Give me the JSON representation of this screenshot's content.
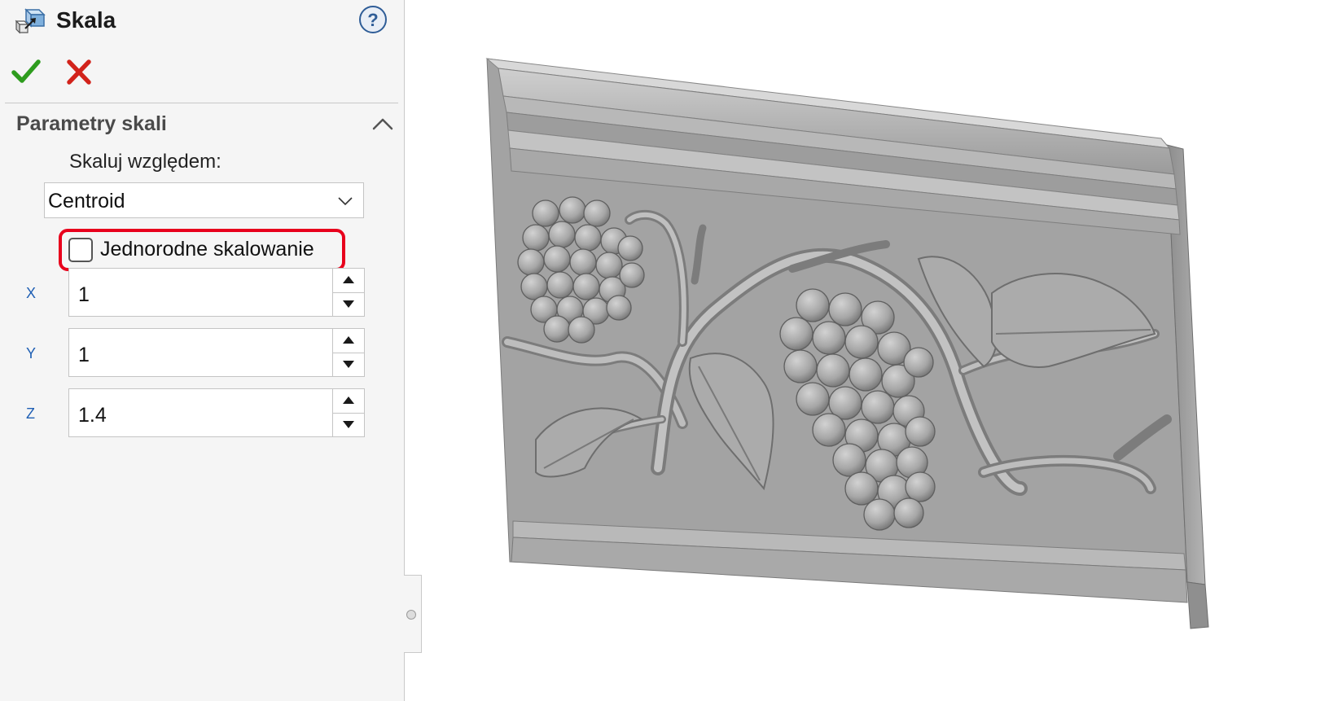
{
  "header": {
    "title": "Skala",
    "feature_icon": "scale-feature-icon",
    "help_icon": "help-icon"
  },
  "actions": {
    "ok_icon": "checkmark-icon",
    "cancel_icon": "close-icon"
  },
  "group": {
    "title": "Parametry skali",
    "collapse_icon": "chevron-up-icon",
    "scale_about_label": "Skaluj względem:",
    "scale_about_value": "Centroid",
    "uniform_scaling_label": "Jednorodne skalowanie",
    "uniform_scaling_checked": false,
    "fields": [
      {
        "axis": "X",
        "value": "1"
      },
      {
        "axis": "Y",
        "value": "1"
      },
      {
        "axis": "Z",
        "value": "1.4"
      }
    ]
  },
  "colors": {
    "ok": "#2e9c1e",
    "cancel": "#d2231b",
    "highlight": "#e8001c",
    "axis_label": "#1f5fb4",
    "model_fill": "#a3a3a3"
  }
}
